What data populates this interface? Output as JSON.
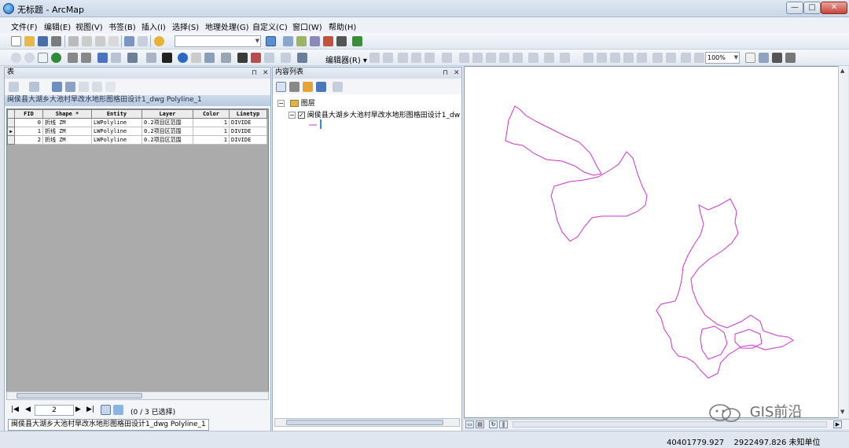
{
  "window": {
    "title": "无标题 - ArcMap",
    "min": "—",
    "max": "□",
    "close": "✕"
  },
  "menu": [
    "文件(F)",
    "编辑(E)",
    "视图(V)",
    "书签(B)",
    "插入(I)",
    "选择(S)",
    "地理处理(G)",
    "自定义(C)",
    "窗口(W)",
    "帮助(H)"
  ],
  "toolbar": {
    "scale_value": "",
    "editor_label": "编辑器(R) ▾",
    "zoom_value": "100%"
  },
  "table_pane": {
    "title": "表",
    "pin": "⊓",
    "close": "✕",
    "tab_title": "闽侯县大湖乡大池村旱改水地形图格田设计1_dwg Polyline_1",
    "columns": [
      "FID",
      "Shape *",
      "Entity",
      "Layer",
      "Color",
      "Linetyp"
    ],
    "rows": [
      [
        "0",
        "折线 ZM",
        "LWPolyline",
        "0.2项目区范围",
        "1",
        "DIVIDE"
      ],
      [
        "1",
        "折线 ZM",
        "LWPolyline",
        "0.2项目区范围",
        "1",
        "DIVIDE"
      ],
      [
        "2",
        "折线 ZM",
        "LWPolyline",
        "0.2项目区范围",
        "1",
        "DIVIDE"
      ]
    ],
    "record": "2",
    "selected_status": "(0 / 3 已选择)",
    "bottom_tab": "闽侯县大湖乡大池村旱改水地形图格田设计1_dwg Polyline_1"
  },
  "toc_pane": {
    "title": "内容列表",
    "pin": "⊓",
    "close": "✕",
    "layers_label": "图层",
    "layer_name": "闽侯县大湖乡大池村旱改水地形图格田设计1_dw"
  },
  "map": {
    "line_color": "#cc33cc"
  },
  "status": {
    "x": "40401779.927",
    "y": "2922497.826",
    "units": "未知单位"
  },
  "watermark": {
    "text": "GIS前沿"
  }
}
